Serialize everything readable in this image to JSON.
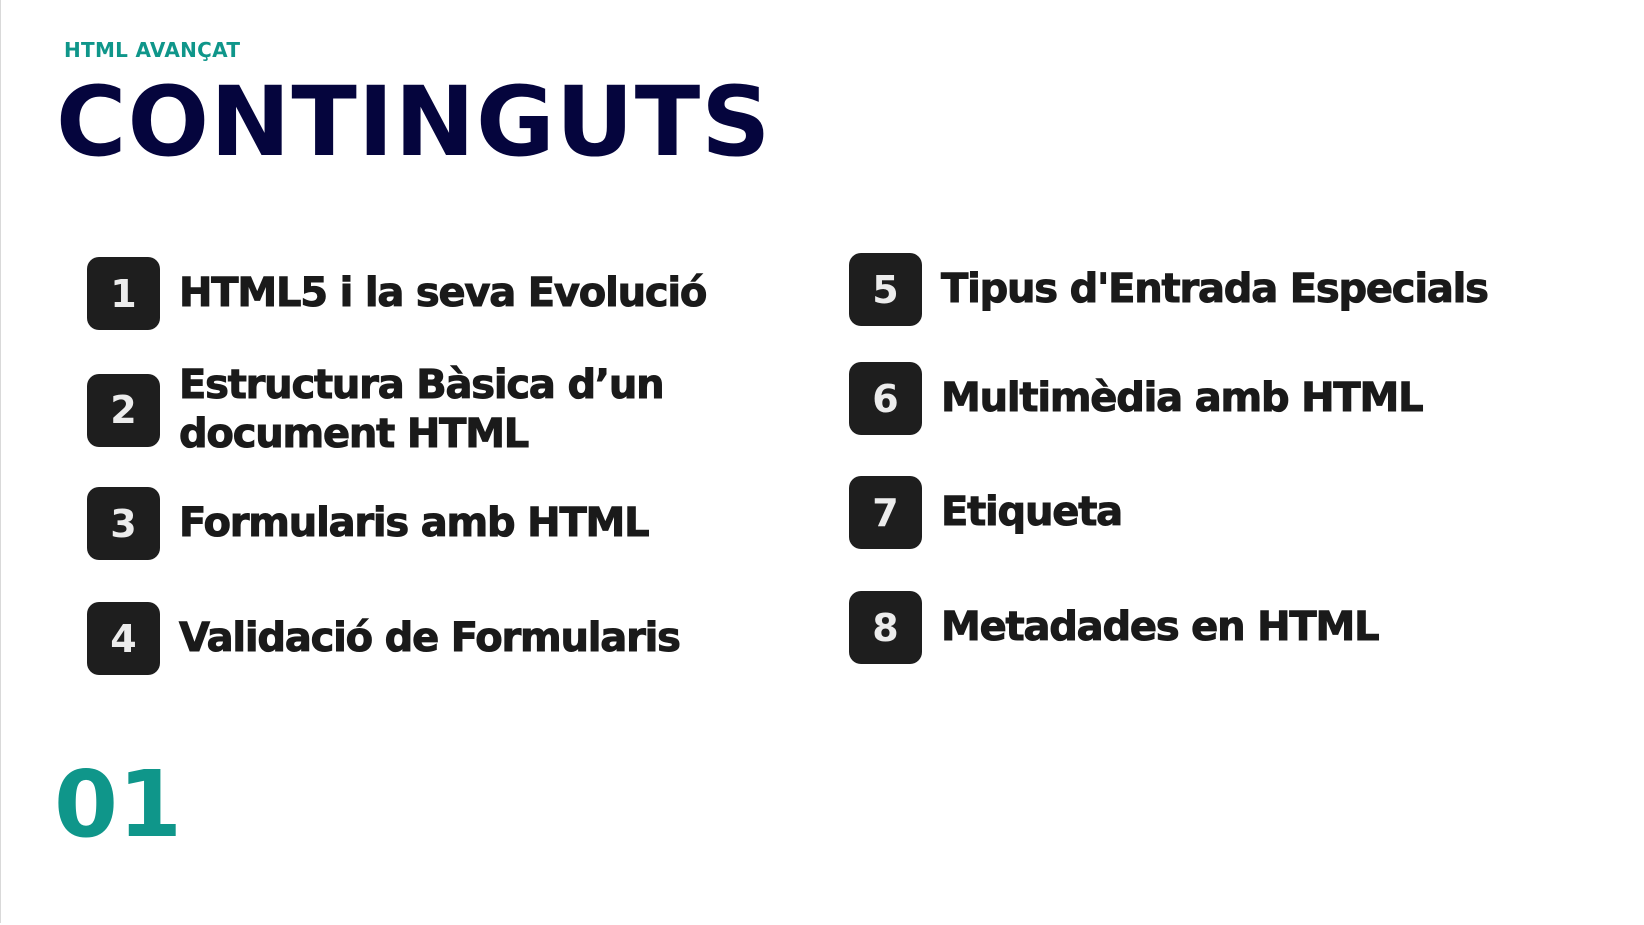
{
  "header": {
    "subtitle": "HTML AVANÇAT",
    "title": "CONTINGUTS"
  },
  "items": [
    {
      "number": "1",
      "label": "HTML5 i la seva Evolució"
    },
    {
      "number": "2",
      "label": "Estructura Bàsica d’un document HTML"
    },
    {
      "number": "3",
      "label": "Formularis amb HTML"
    },
    {
      "number": "4",
      "label": "Validació de Formularis"
    },
    {
      "number": "5",
      "label": "Tipus d'Entrada Especials"
    },
    {
      "number": "6",
      "label": "Multimèdia amb HTML"
    },
    {
      "number": "7",
      "label": "Etiqueta"
    },
    {
      "number": "8",
      "label": "Metadades en HTML"
    }
  ],
  "footer": {
    "slide_number": "01"
  },
  "colors": {
    "accent": "#0f968a",
    "title": "#05053d",
    "badge": "#1e1e1e",
    "text": "#1a1a1a"
  }
}
